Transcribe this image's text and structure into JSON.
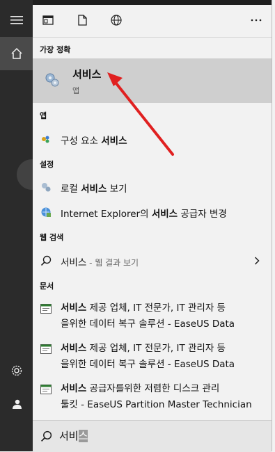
{
  "search": {
    "query_typed": "서비",
    "query_highlight": "스"
  },
  "best_match": {
    "header": "가장 정확",
    "title": "서비스",
    "subtitle": "앱"
  },
  "apps": {
    "header": "앱",
    "item": {
      "prefix": "구성 요소 ",
      "bold": "서비스"
    }
  },
  "settings": {
    "header": "설정",
    "items": [
      {
        "prefix": "로컬 ",
        "bold": "서비스",
        "suffix": " 보기"
      },
      {
        "prefix": "Internet Explorer의 ",
        "bold": "서비스",
        "suffix": " 공급자 변경"
      }
    ]
  },
  "web": {
    "header": "웹 검색",
    "item": {
      "text": "서비스",
      "suffix": " - 웹 결과 보기"
    }
  },
  "docs": {
    "header": "문서",
    "items": [
      {
        "bold": "서비스",
        "line1_rest": " 제공 업체, IT 전문가, IT 관리자 등",
        "line2": "을위한 데이터 복구 솔루션 - EaseUS Data"
      },
      {
        "bold": "서비스",
        "line1_rest": " 제공 업체, IT 전문가, IT 관리자 등",
        "line2": "을위한 데이터 복구 솔루션 - EaseUS Data"
      },
      {
        "bold": "서비스",
        "line1_rest": " 공급자를위한 저렴한 디스크 관리",
        "line2": "툴킷 - EaseUS Partition Master Technician"
      }
    ]
  },
  "icons": {
    "rail": [
      "hamburger-icon",
      "home-icon",
      "settings-gear-icon",
      "user-icon"
    ],
    "toolbar": [
      "app-window-icon",
      "document-icon",
      "globe-icon",
      "more-icon"
    ]
  },
  "colors": {
    "annotation_arrow": "#e02020",
    "best_match_bg": "#cfcfcf",
    "rail_bg": "#2b2b2b"
  }
}
